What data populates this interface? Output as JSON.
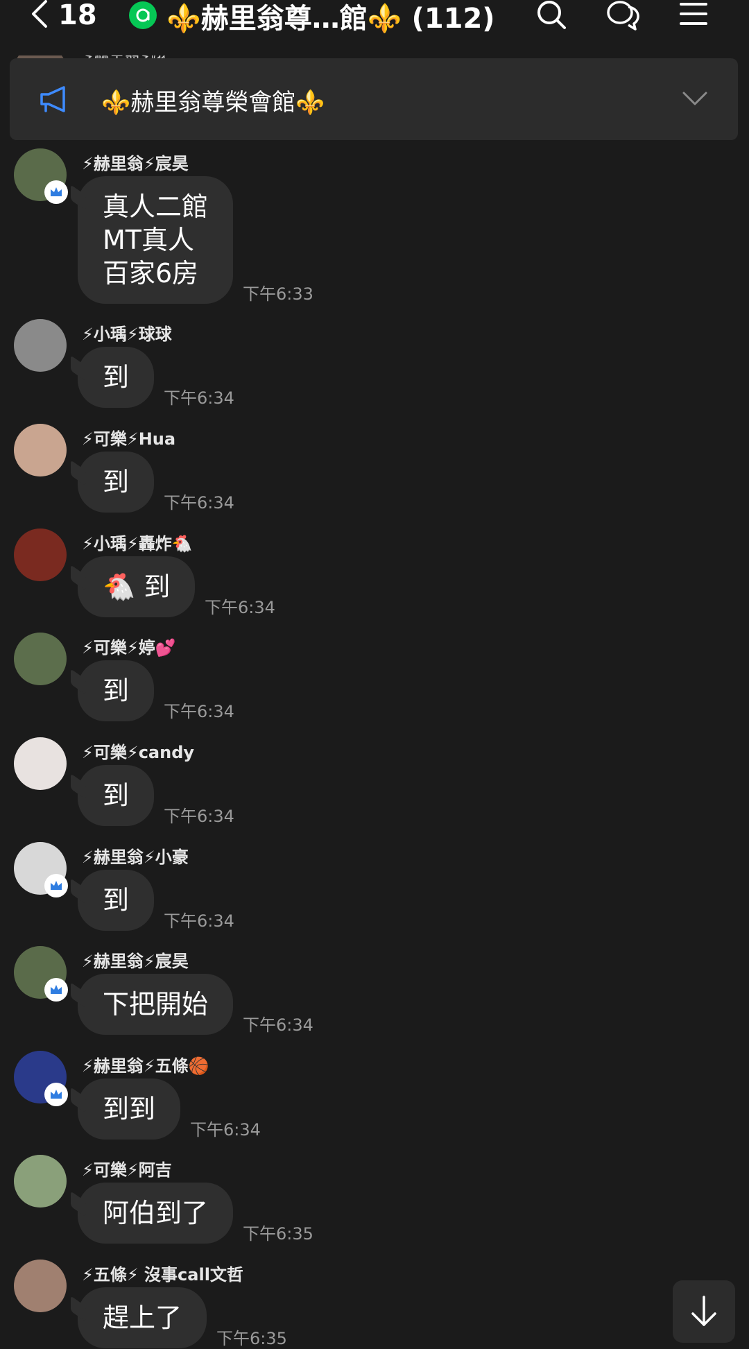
{
  "header": {
    "back_count": "18",
    "title": "⚜️赫里翁尊…館⚜️ (112)"
  },
  "partial_sender": "⚡赫里翁⚡翊翊",
  "announcement": {
    "text": "⚜️赫里翁尊榮會館⚜️"
  },
  "messages": [
    {
      "sender": "⚡赫里翁⚡宸昊",
      "text": "真人二館\nMT真人\n百家6房",
      "time": "下午6:33",
      "crown": true,
      "avatar_color": "#5a6b4a"
    },
    {
      "sender": "⚡小瑀⚡球球",
      "text": "到",
      "time": "下午6:34",
      "crown": false,
      "avatar_color": "#8a8a8a"
    },
    {
      "sender": "⚡可樂⚡Hua",
      "text": "到",
      "time": "下午6:34",
      "crown": false,
      "avatar_color": "#c9a590"
    },
    {
      "sender": "⚡小瑀⚡轟炸🐔",
      "text": "🐔 到",
      "time": "下午6:34",
      "crown": false,
      "avatar_color": "#7a2a20"
    },
    {
      "sender": "⚡可樂⚡婷💕",
      "text": "到",
      "time": "下午6:34",
      "crown": false,
      "avatar_color": "#5c6e4c"
    },
    {
      "sender": "⚡可樂⚡candy",
      "text": "到",
      "time": "下午6:34",
      "crown": false,
      "avatar_color": "#e8e2e0"
    },
    {
      "sender": "⚡赫里翁⚡小豪",
      "text": "到",
      "time": "下午6:34",
      "crown": true,
      "avatar_color": "#d8d8d8"
    },
    {
      "sender": "⚡赫里翁⚡宸昊",
      "text": "下把開始",
      "time": "下午6:34",
      "crown": true,
      "avatar_color": "#5a6b4a"
    },
    {
      "sender": "⚡赫里翁⚡五條🏀",
      "text": "到到",
      "time": "下午6:34",
      "crown": true,
      "avatar_color": "#2a3a8a"
    },
    {
      "sender": "⚡可樂⚡阿吉",
      "text": "阿伯到了",
      "time": "下午6:35",
      "crown": false,
      "avatar_color": "#8aa07a"
    },
    {
      "sender": "⚡五條⚡ 沒事call文哲",
      "text": "趕上了",
      "time": "下午6:35",
      "crown": false,
      "avatar_color": "#a08070"
    }
  ],
  "icons": {
    "back": "chevron-left-icon",
    "verified": "verified-badge-icon",
    "search": "search-icon",
    "threads": "chat-bubbles-icon",
    "menu": "hamburger-menu-icon",
    "announcement": "megaphone-icon",
    "expand": "chevron-down-icon",
    "scroll_down": "arrow-down-icon",
    "crown": "crown-icon"
  },
  "colors": {
    "background": "#1b1b1b",
    "bubble": "#2f2f2f",
    "accent_blue": "#3e8bff",
    "line_green": "#06c755"
  }
}
